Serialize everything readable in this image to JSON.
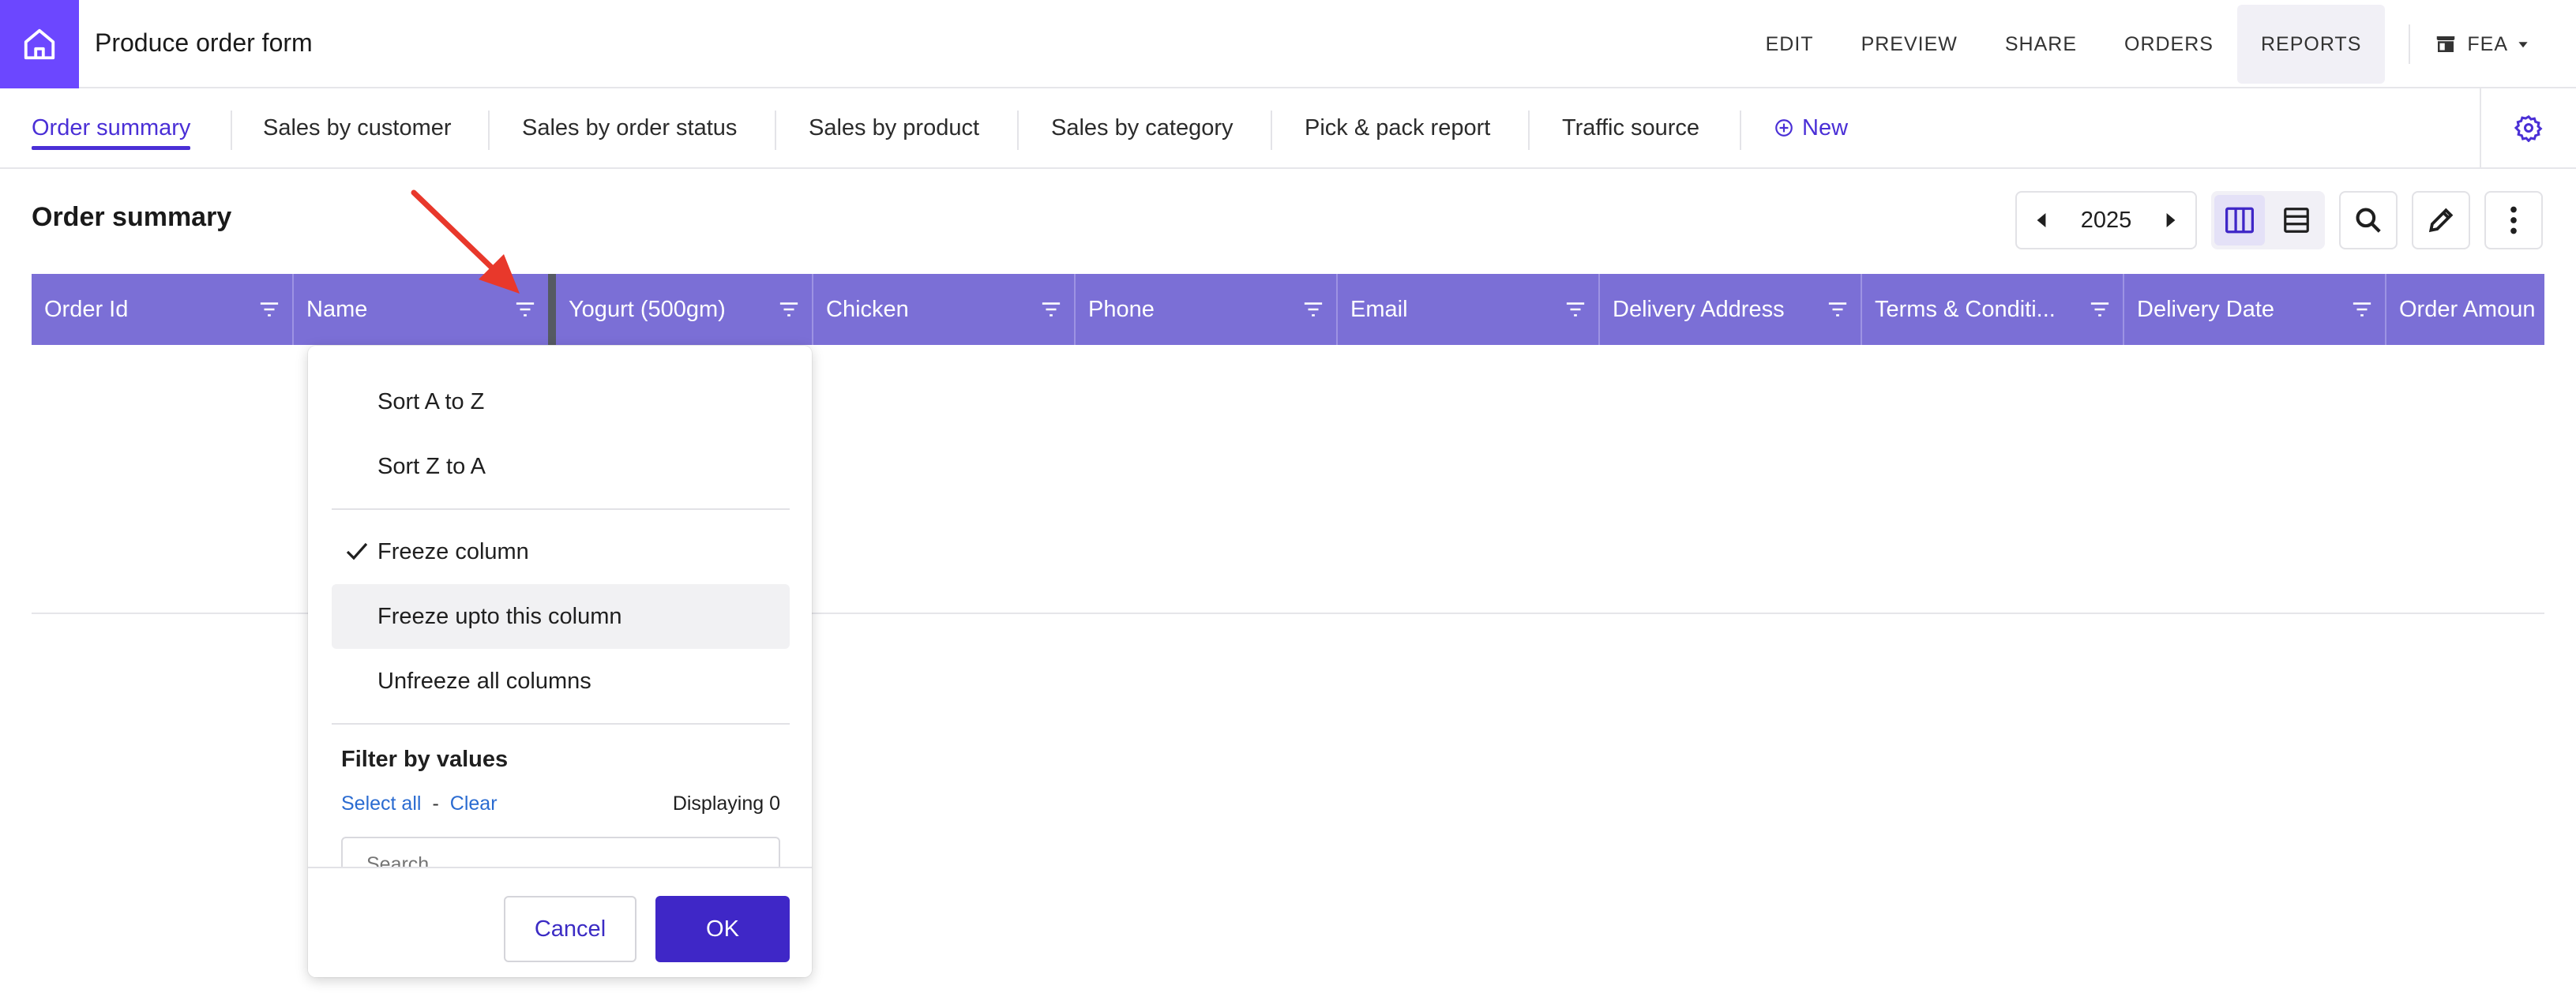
{
  "app": {
    "title": "Produce order form",
    "home_icon": "home-icon"
  },
  "topnav": {
    "items": [
      {
        "label": "EDIT"
      },
      {
        "label": "PREVIEW"
      },
      {
        "label": "SHARE"
      },
      {
        "label": "ORDERS"
      },
      {
        "label": "REPORTS",
        "active": true
      }
    ],
    "store_label": "FEA"
  },
  "tabs": {
    "items": [
      {
        "label": "Order summary",
        "active": true
      },
      {
        "label": "Sales by customer"
      },
      {
        "label": "Sales by order status"
      },
      {
        "label": "Sales by product"
      },
      {
        "label": "Sales by category"
      },
      {
        "label": "Pick & pack report"
      },
      {
        "label": "Traffic source"
      }
    ],
    "new_label": "New"
  },
  "section": {
    "title": "Order summary",
    "year": "2025"
  },
  "table": {
    "columns": [
      "Order Id",
      "Name",
      "Yogurt (500gm)",
      "Chicken",
      "Phone",
      "Email",
      "Delivery Address",
      "Terms & Conditi...",
      "Delivery Date",
      "Order Amoun"
    ]
  },
  "dropdown": {
    "sort_asc": "Sort A to Z",
    "sort_desc": "Sort Z to A",
    "freeze_column": "Freeze column",
    "freeze_upto": "Freeze upto this column",
    "unfreeze_all": "Unfreeze all columns",
    "filter_title": "Filter by values",
    "select_all": "Select all",
    "dash": "-",
    "clear": "Clear",
    "displaying": "Displaying 0",
    "search_placeholder": "Search",
    "cancel": "Cancel",
    "ok": "OK"
  },
  "colors": {
    "accent": "#6c47ff",
    "header": "#7b6fd6",
    "primary_button": "#3f27c7",
    "annotation": "#e8382b"
  }
}
